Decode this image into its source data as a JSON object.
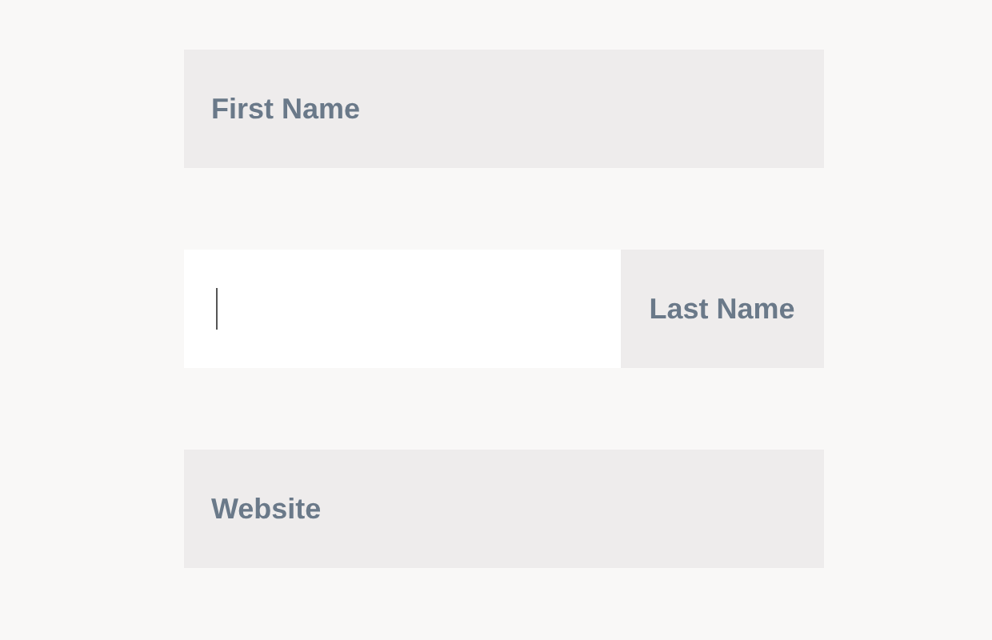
{
  "fields": [
    {
      "label": "First Name",
      "focused": false
    },
    {
      "label": "Last Name",
      "focused": true
    },
    {
      "label": "Website",
      "focused": false
    }
  ]
}
